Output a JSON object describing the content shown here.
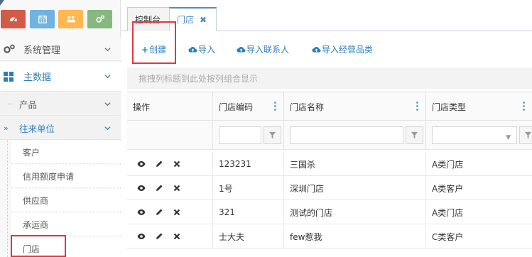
{
  "sidebar": {
    "shortcuts": [
      {
        "icon": "speedometer-icon",
        "color": "#d15b47"
      },
      {
        "icon": "calendar-icon",
        "color": "#6fb3e0"
      },
      {
        "icon": "users-icon",
        "color": "#ffb752"
      },
      {
        "icon": "gears-icon",
        "color": "#87b87f"
      }
    ],
    "system_label": "系统管理",
    "master_label": "主数据",
    "product_label": "产品",
    "contacts_label": "往来单位",
    "leaves": [
      "客户",
      "信用额度申请",
      "供应商",
      "承运商",
      "门店"
    ]
  },
  "tabs": [
    {
      "label": "控制台"
    },
    {
      "label": "门店",
      "active": true,
      "close": "✖"
    }
  ],
  "toolbar": {
    "create_plus": "+",
    "create_label": "创建",
    "import_label": "导入",
    "import_contacts_label": "导入联系人",
    "import_categories_label": "导入经营品类"
  },
  "grid": {
    "group_hint": "拖拽列标题到此处按列组合显示",
    "headers": [
      "操作",
      "门店编码",
      "门店名称",
      "门店类型"
    ],
    "rows": [
      {
        "code": "123231",
        "name": "三国杀",
        "type": "A类门店"
      },
      {
        "code": "1号",
        "name": "深圳门店",
        "type": "A类客户"
      },
      {
        "code": "321",
        "name": "测试的门店",
        "type": "A类门店"
      },
      {
        "code": "士大夫",
        "name": "few惹我",
        "type": "C类客户"
      }
    ]
  },
  "colors": {
    "accent": "#2b7dbc",
    "highlight_box": "#e0383c"
  }
}
